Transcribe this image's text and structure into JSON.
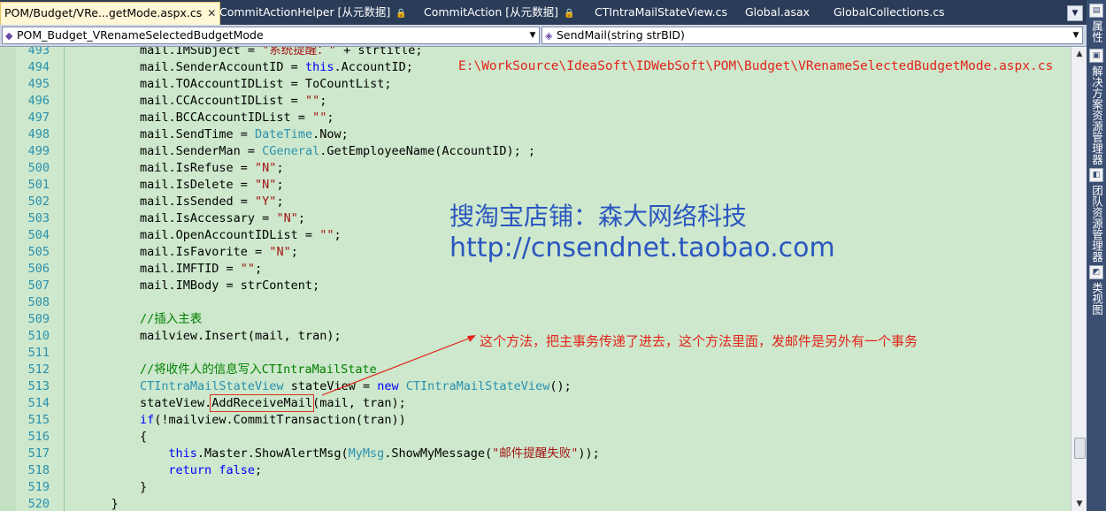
{
  "tabs": [
    {
      "label": "POM/Budget/VRe...getMode.aspx.cs",
      "active": true,
      "locked": false
    },
    {
      "label": "CommitActionHelper [从元数据]",
      "active": false,
      "locked": true
    },
    {
      "label": "CommitAction [从元数据]",
      "active": false,
      "locked": true
    },
    {
      "label": "CTIntraMailStateView.cs",
      "active": false,
      "locked": false
    },
    {
      "label": "Global.asax",
      "active": false,
      "locked": false
    },
    {
      "label": "GlobalCollections.cs",
      "active": false,
      "locked": false
    }
  ],
  "nav": {
    "class_combo": "POM_Budget_VRenameSelectedBudgetMode",
    "member_combo": "SendMail(string strBID)"
  },
  "icons": {
    "class": "class-icon",
    "method": "method-icon",
    "close": "close-icon",
    "lock": "lock-icon",
    "dropdown": "chevron-down-icon"
  },
  "lines": [
    {
      "n": "493",
      "indent": 10,
      "tokens": [
        [
          "",
          "mail.IMSubject = "
        ],
        [
          "st",
          "\"系统提醒：\""
        ],
        [
          "",
          " + strtitle;"
        ]
      ]
    },
    {
      "n": "494",
      "indent": 10,
      "tokens": [
        [
          "",
          "mail.SenderAccountID = "
        ],
        [
          "kw",
          "this"
        ],
        [
          "",
          ".AccountID;"
        ]
      ]
    },
    {
      "n": "495",
      "indent": 10,
      "tokens": [
        [
          "",
          "mail.TOAccountIDList = ToCountList;"
        ]
      ]
    },
    {
      "n": "496",
      "indent": 10,
      "tokens": [
        [
          "",
          "mail.CCAccountIDList = "
        ],
        [
          "st",
          "\"\""
        ],
        [
          "",
          ";"
        ]
      ]
    },
    {
      "n": "497",
      "indent": 10,
      "tokens": [
        [
          "",
          "mail.BCCAccountIDList = "
        ],
        [
          "st",
          "\"\""
        ],
        [
          "",
          ";"
        ]
      ]
    },
    {
      "n": "498",
      "indent": 10,
      "tokens": [
        [
          "",
          "mail.SendTime = "
        ],
        [
          "ty",
          "DateTime"
        ],
        [
          "",
          ".Now;"
        ]
      ]
    },
    {
      "n": "499",
      "indent": 10,
      "tokens": [
        [
          "",
          "mail.SenderMan = "
        ],
        [
          "ty",
          "CGeneral"
        ],
        [
          "",
          ".GetEmployeeName(AccountID); ;"
        ]
      ]
    },
    {
      "n": "500",
      "indent": 10,
      "tokens": [
        [
          "",
          "mail.IsRefuse = "
        ],
        [
          "st",
          "\"N\""
        ],
        [
          "",
          ";"
        ]
      ]
    },
    {
      "n": "501",
      "indent": 10,
      "tokens": [
        [
          "",
          "mail.IsDelete = "
        ],
        [
          "st",
          "\"N\""
        ],
        [
          "",
          ";"
        ]
      ]
    },
    {
      "n": "502",
      "indent": 10,
      "tokens": [
        [
          "",
          "mail.IsSended = "
        ],
        [
          "st",
          "\"Y\""
        ],
        [
          "",
          ";"
        ]
      ]
    },
    {
      "n": "503",
      "indent": 10,
      "tokens": [
        [
          "",
          "mail.IsAccessary = "
        ],
        [
          "st",
          "\"N\""
        ],
        [
          "",
          ";"
        ]
      ]
    },
    {
      "n": "504",
      "indent": 10,
      "tokens": [
        [
          "",
          "mail.OpenAccountIDList = "
        ],
        [
          "st",
          "\"\""
        ],
        [
          "",
          ";"
        ]
      ]
    },
    {
      "n": "505",
      "indent": 10,
      "tokens": [
        [
          "",
          "mail.IsFavorite = "
        ],
        [
          "st",
          "\"N\""
        ],
        [
          "",
          ";"
        ]
      ]
    },
    {
      "n": "506",
      "indent": 10,
      "tokens": [
        [
          "",
          "mail.IMFTID = "
        ],
        [
          "st",
          "\"\""
        ],
        [
          "",
          ";"
        ]
      ]
    },
    {
      "n": "507",
      "indent": 10,
      "tokens": [
        [
          "",
          "mail.IMBody = strContent;"
        ]
      ]
    },
    {
      "n": "508",
      "indent": 10,
      "tokens": []
    },
    {
      "n": "509",
      "indent": 10,
      "tokens": [
        [
          "cm",
          "//插入主表"
        ]
      ]
    },
    {
      "n": "510",
      "indent": 10,
      "tokens": [
        [
          "",
          "mailview.Insert(mail, tran);"
        ]
      ]
    },
    {
      "n": "511",
      "indent": 10,
      "tokens": []
    },
    {
      "n": "512",
      "indent": 10,
      "tokens": [
        [
          "cm",
          "//将收件人的信息写入CTIntraMailState"
        ]
      ]
    },
    {
      "n": "513",
      "indent": 10,
      "tokens": [
        [
          "ty",
          "CTIntraMailStateView"
        ],
        [
          "",
          " stateView = "
        ],
        [
          "kw",
          "new"
        ],
        [
          "",
          " "
        ],
        [
          "ty",
          "CTIntraMailStateView"
        ],
        [
          "",
          "();"
        ]
      ]
    },
    {
      "n": "514",
      "indent": 10,
      "tokens": [
        [
          "",
          "stateView."
        ],
        [
          "hl",
          "AddReceiveMail"
        ],
        [
          "",
          "(mail, tran);"
        ]
      ]
    },
    {
      "n": "515",
      "indent": 10,
      "tokens": [
        [
          "kw",
          "if"
        ],
        [
          "",
          "(!mailview.CommitTransaction(tran))"
        ]
      ]
    },
    {
      "n": "516",
      "indent": 10,
      "tokens": [
        [
          "",
          "{"
        ]
      ]
    },
    {
      "n": "517",
      "indent": 14,
      "tokens": [
        [
          "kw",
          "this"
        ],
        [
          "",
          ".Master.ShowAlertMsg("
        ],
        [
          "ty",
          "MyMsg"
        ],
        [
          "",
          ".ShowMyMessage("
        ],
        [
          "st",
          "\"邮件提醒失败\""
        ],
        [
          "",
          "));"
        ]
      ]
    },
    {
      "n": "518",
      "indent": 14,
      "tokens": [
        [
          "kw",
          "return"
        ],
        [
          "",
          " "
        ],
        [
          "kw",
          "false"
        ],
        [
          "",
          ";"
        ]
      ]
    },
    {
      "n": "519",
      "indent": 10,
      "tokens": [
        [
          "",
          "}"
        ]
      ]
    },
    {
      "n": "520",
      "indent": 6,
      "tokens": [
        [
          "",
          "}"
        ]
      ]
    }
  ],
  "overlay": {
    "file_path": "E:\\WorkSource\\IdeaSoft\\IDWebSoft\\POM\\Budget\\VRenameSelectedBudgetMode.aspx.cs",
    "watermark_line1": "搜淘宝店铺：森大网络科技",
    "watermark_line2": "http://cnsendnet.taobao.com",
    "annotation": "这个方法，把主事务传递了进去，这个方法里面，发邮件是另外有一个事务"
  },
  "sidebar": [
    {
      "label": "属性",
      "icon": "properties-icon"
    },
    {
      "label": "解决方案资源管理器",
      "icon": "solution-explorer-icon"
    },
    {
      "label": "团队资源管理器",
      "icon": "team-explorer-icon"
    },
    {
      "label": "类视图",
      "icon": "class-view-icon"
    }
  ],
  "colors": {
    "editor_bg": "#cde8cc",
    "keyword": "#0000ff",
    "type": "#2b91af",
    "string": "#a31515",
    "comment": "#008000",
    "annotation_red": "#e2241b",
    "watermark_blue": "#2b56c0"
  }
}
